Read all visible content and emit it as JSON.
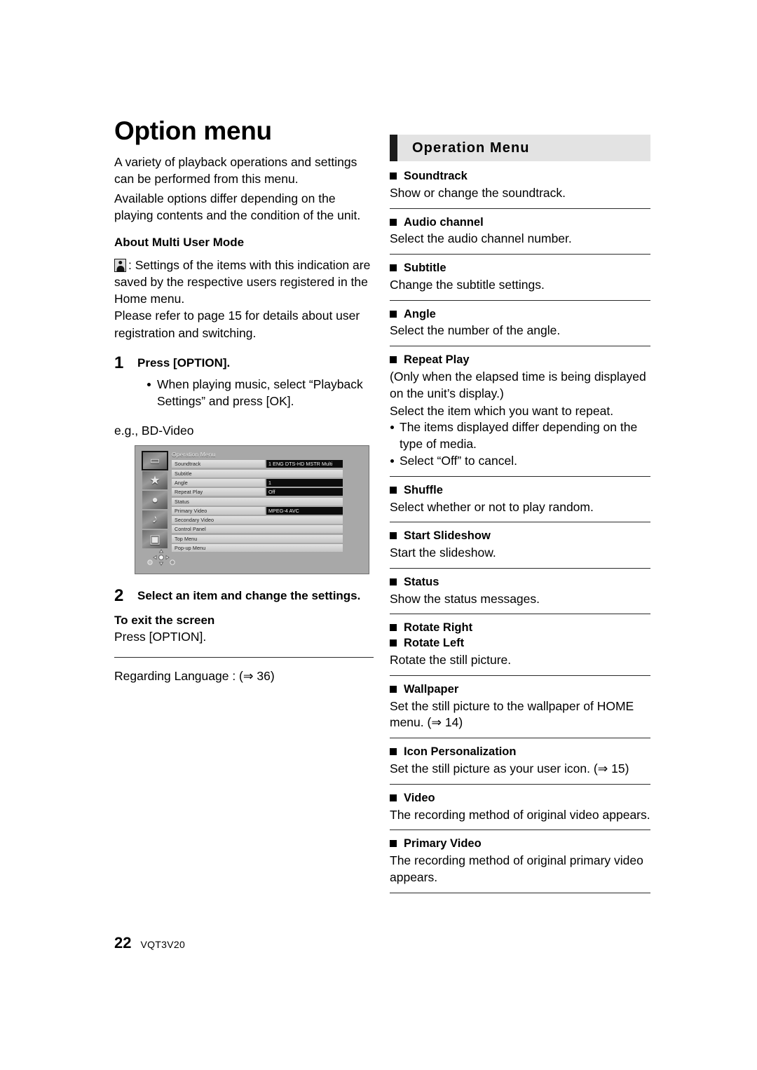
{
  "page": {
    "number": "22",
    "doc_code": "VQT3V20"
  },
  "left": {
    "title": "Option menu",
    "intro_1": "A variety of playback operations and settings can be performed from this menu.",
    "intro_2": "Available options differ depending on the playing contents and the condition of the unit.",
    "multi_user_heading": "About Multi User Mode",
    "multi_user_icon": "user-silhouette-icon",
    "multi_user_text_1": ": Settings of the items with this indication are saved by the respective users registered in the Home menu.",
    "multi_user_text_2": "Please refer to page 15 for details about user registration and switching.",
    "step1": {
      "number": "1",
      "title": "Press [OPTION].",
      "bullet": "When playing music, select “Playback Settings” and press [OK]."
    },
    "example_label": "e.g., BD-Video",
    "step2": {
      "number": "2",
      "title": "Select an item and change the settings."
    },
    "exit_heading": "To exit the screen",
    "exit_text": "Press [OPTION].",
    "regarding_language": "Regarding Language : (⇒ 36)"
  },
  "device_screenshot": {
    "title": "Operation Menu",
    "sidebar_icons": [
      {
        "name": "video-disc-icon",
        "glyph": "▭",
        "selected": true
      },
      {
        "name": "star-icon",
        "glyph": "★",
        "selected": false
      },
      {
        "name": "photo-camera-icon",
        "glyph": "●",
        "selected": false
      },
      {
        "name": "music-note-icon",
        "glyph": "♪",
        "selected": false
      },
      {
        "name": "cube-icon",
        "glyph": "▣",
        "selected": false
      }
    ],
    "rows": [
      {
        "label": "Soundtrack",
        "value": "1 ENG DTS-HD MSTR Multi",
        "has_value": true
      },
      {
        "label": "Subtitle",
        "value": "",
        "has_value": false
      },
      {
        "label": "Angle",
        "value": "1",
        "has_value": true
      },
      {
        "label": "Repeat Play",
        "value": "Off",
        "has_value": true
      },
      {
        "label": "Status",
        "value": "",
        "has_value": false
      },
      {
        "label": "Primary Video",
        "value": "MPEG-4 AVC",
        "has_value": true
      },
      {
        "label": "Secondary Video",
        "value": "",
        "has_value": false
      },
      {
        "label": "Control Panel",
        "value": "",
        "has_value": false
      },
      {
        "label": "Top Menu",
        "value": "",
        "has_value": false
      },
      {
        "label": "Pop-up Menu",
        "value": "",
        "has_value": false
      }
    ],
    "dpad_icon": "direction-pad-icon"
  },
  "right": {
    "section_title": "Operation Menu",
    "entries": [
      {
        "title": "Soundtrack",
        "lines": [
          "Show or change the soundtrack."
        ],
        "bullets": []
      },
      {
        "title": "Audio channel",
        "lines": [
          "Select the audio channel number."
        ],
        "bullets": []
      },
      {
        "title": "Subtitle",
        "lines": [
          "Change the subtitle settings."
        ],
        "bullets": []
      },
      {
        "title": "Angle",
        "lines": [
          "Select the number of the angle."
        ],
        "bullets": []
      },
      {
        "title": "Repeat Play",
        "lines": [
          "(Only when the elapsed time is being displayed on the unit’s display.)",
          "Select the item which you want to repeat."
        ],
        "bullets": [
          "The items displayed differ depending on the type of media.",
          "Select “Off” to cancel."
        ]
      },
      {
        "title": "Shuffle",
        "lines": [
          "Select whether or not to play random."
        ],
        "bullets": []
      },
      {
        "title": "Start Slideshow",
        "lines": [
          "Start the slideshow."
        ],
        "bullets": []
      },
      {
        "title": "Status",
        "lines": [
          "Show the status messages."
        ],
        "bullets": []
      },
      {
        "title": "Rotate Right",
        "title2": "Rotate Left",
        "lines": [
          "Rotate the still picture."
        ],
        "bullets": []
      },
      {
        "title": "Wallpaper",
        "lines": [
          "Set the still picture to the wallpaper of HOME menu. (⇒ 14)"
        ],
        "bullets": []
      },
      {
        "title": "Icon Personalization",
        "lines": [
          "Set the still picture as your user icon. (⇒ 15)"
        ],
        "bullets": []
      },
      {
        "title": "Video",
        "lines": [
          "The recording method of original video appears."
        ],
        "bullets": []
      },
      {
        "title": "Primary Video",
        "lines": [
          "The recording method of original primary video appears."
        ],
        "bullets": []
      }
    ]
  }
}
